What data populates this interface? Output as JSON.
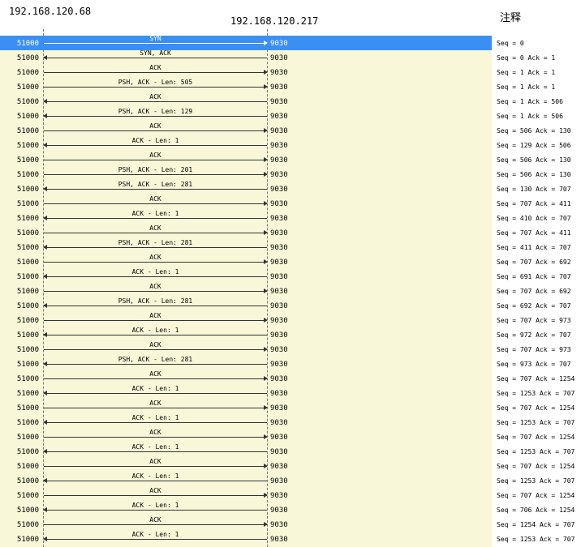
{
  "header": {
    "host_a": "192.168.120.68",
    "host_b": "192.168.120.217",
    "comment_col": "注释"
  },
  "rows": [
    {
      "port_a": "51000",
      "port_b": "9030",
      "label": "SYN",
      "dir": "right",
      "note": "Seq = 0",
      "selected": true
    },
    {
      "port_a": "51000",
      "port_b": "9030",
      "label": "SYN, ACK",
      "dir": "left",
      "note": "Seq = 0 Ack = 1"
    },
    {
      "port_a": "51000",
      "port_b": "9030",
      "label": "ACK",
      "dir": "right",
      "note": "Seq = 1 Ack = 1"
    },
    {
      "port_a": "51000",
      "port_b": "9030",
      "label": "PSH, ACK - Len: 505",
      "dir": "right",
      "note": "Seq = 1 Ack = 1"
    },
    {
      "port_a": "51000",
      "port_b": "9030",
      "label": "ACK",
      "dir": "left",
      "note": "Seq = 1 Ack = 506"
    },
    {
      "port_a": "51000",
      "port_b": "9030",
      "label": "PSH, ACK - Len: 129",
      "dir": "left",
      "note": "Seq = 1 Ack = 506"
    },
    {
      "port_a": "51000",
      "port_b": "9030",
      "label": "ACK",
      "dir": "right",
      "note": "Seq = 506 Ack = 130"
    },
    {
      "port_a": "51000",
      "port_b": "9030",
      "label": "ACK - Len: 1",
      "dir": "left",
      "note": "Seq = 129 Ack = 506"
    },
    {
      "port_a": "51000",
      "port_b": "9030",
      "label": "ACK",
      "dir": "right",
      "note": "Seq = 506 Ack = 130"
    },
    {
      "port_a": "51000",
      "port_b": "9030",
      "label": "PSH, ACK - Len: 201",
      "dir": "right",
      "note": "Seq = 506 Ack = 130"
    },
    {
      "port_a": "51000",
      "port_b": "9030",
      "label": "PSH, ACK - Len: 281",
      "dir": "left",
      "note": "Seq = 130 Ack = 707"
    },
    {
      "port_a": "51000",
      "port_b": "9030",
      "label": "ACK",
      "dir": "right",
      "note": "Seq = 707 Ack = 411"
    },
    {
      "port_a": "51000",
      "port_b": "9030",
      "label": "ACK - Len: 1",
      "dir": "left",
      "note": "Seq = 410 Ack = 707"
    },
    {
      "port_a": "51000",
      "port_b": "9030",
      "label": "ACK",
      "dir": "right",
      "note": "Seq = 707 Ack = 411"
    },
    {
      "port_a": "51000",
      "port_b": "9030",
      "label": "PSH, ACK - Len: 281",
      "dir": "left",
      "note": "Seq = 411 Ack = 707"
    },
    {
      "port_a": "51000",
      "port_b": "9030",
      "label": "ACK",
      "dir": "right",
      "note": "Seq = 707 Ack = 692"
    },
    {
      "port_a": "51000",
      "port_b": "9030",
      "label": "ACK - Len: 1",
      "dir": "left",
      "note": "Seq = 691 Ack = 707"
    },
    {
      "port_a": "51000",
      "port_b": "9030",
      "label": "ACK",
      "dir": "right",
      "note": "Seq = 707 Ack = 692"
    },
    {
      "port_a": "51000",
      "port_b": "9030",
      "label": "PSH, ACK - Len: 281",
      "dir": "left",
      "note": "Seq = 692 Ack = 707"
    },
    {
      "port_a": "51000",
      "port_b": "9030",
      "label": "ACK",
      "dir": "right",
      "note": "Seq = 707 Ack = 973"
    },
    {
      "port_a": "51000",
      "port_b": "9030",
      "label": "ACK - Len: 1",
      "dir": "left",
      "note": "Seq = 972 Ack = 707"
    },
    {
      "port_a": "51000",
      "port_b": "9030",
      "label": "ACK",
      "dir": "right",
      "note": "Seq = 707 Ack = 973"
    },
    {
      "port_a": "51000",
      "port_b": "9030",
      "label": "PSH, ACK - Len: 281",
      "dir": "left",
      "note": "Seq = 973 Ack = 707"
    },
    {
      "port_a": "51000",
      "port_b": "9030",
      "label": "ACK",
      "dir": "right",
      "note": "Seq = 707 Ack = 1254"
    },
    {
      "port_a": "51000",
      "port_b": "9030",
      "label": "ACK - Len: 1",
      "dir": "left",
      "note": "Seq = 1253 Ack = 707"
    },
    {
      "port_a": "51000",
      "port_b": "9030",
      "label": "ACK",
      "dir": "right",
      "note": "Seq = 707 Ack = 1254"
    },
    {
      "port_a": "51000",
      "port_b": "9030",
      "label": "ACK - Len: 1",
      "dir": "left",
      "note": "Seq = 1253 Ack = 707"
    },
    {
      "port_a": "51000",
      "port_b": "9030",
      "label": "ACK",
      "dir": "right",
      "note": "Seq = 707 Ack = 1254"
    },
    {
      "port_a": "51000",
      "port_b": "9030",
      "label": "ACK - Len: 1",
      "dir": "left",
      "note": "Seq = 1253 Ack = 707"
    },
    {
      "port_a": "51000",
      "port_b": "9030",
      "label": "ACK",
      "dir": "right",
      "note": "Seq = 707 Ack = 1254"
    },
    {
      "port_a": "51000",
      "port_b": "9030",
      "label": "ACK - Len: 1",
      "dir": "left",
      "note": "Seq = 1253 Ack = 707"
    },
    {
      "port_a": "51000",
      "port_b": "9030",
      "label": "ACK",
      "dir": "right",
      "note": "Seq = 707 Ack = 1254"
    },
    {
      "port_a": "51000",
      "port_b": "9030",
      "label": "ACK - Len: 1",
      "dir": "left",
      "note": "Seq = 706 Ack = 1254"
    },
    {
      "port_a": "51000",
      "port_b": "9030",
      "label": "ACK",
      "dir": "right",
      "note": "Seq = 1254 Ack = 707"
    },
    {
      "port_a": "51000",
      "port_b": "9030",
      "label": "ACK - Len: 1",
      "dir": "left",
      "note": "Seq = 1253 Ack = 707"
    }
  ]
}
